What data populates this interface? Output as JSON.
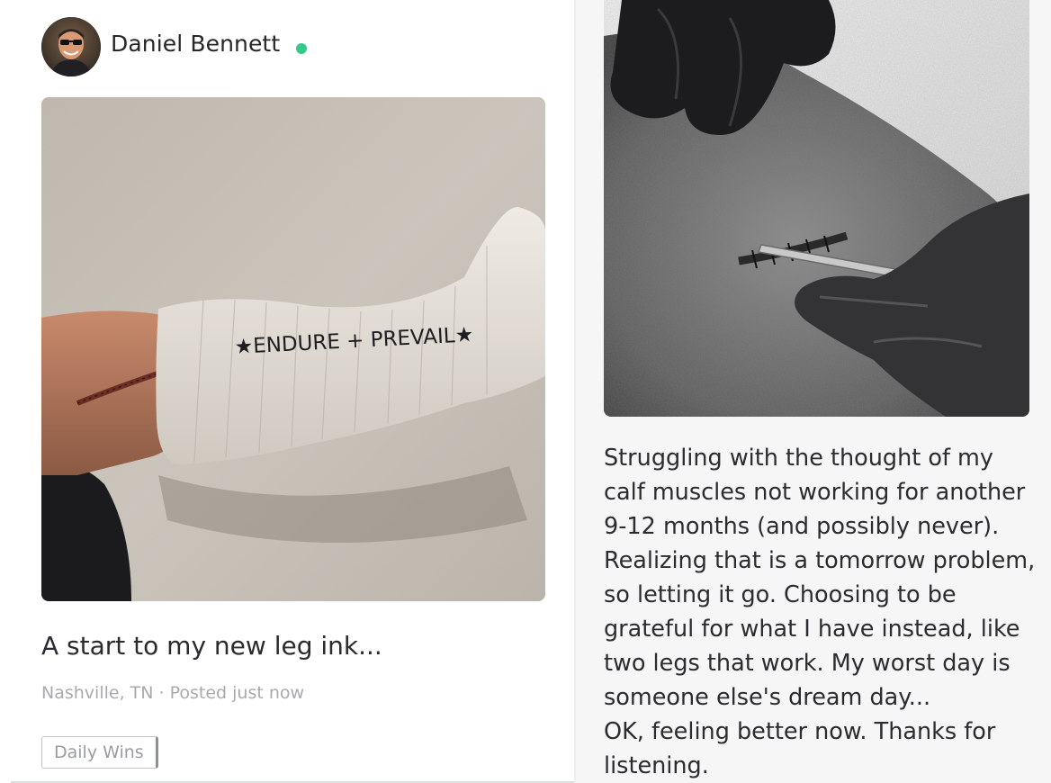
{
  "left_post": {
    "user": {
      "name": "Daniel Bennett",
      "online": true,
      "status_color": "#35c98a"
    },
    "image": {
      "cast_writing": "★ENDURE + PREVAIL★"
    },
    "caption": "A start to my new leg ink...",
    "meta": "Nashville, TN · Posted just now",
    "tag": "Daily Wins"
  },
  "right_post": {
    "text_lines": [
      "Struggling with the thought of my",
      "calf muscles not working for another",
      "9-12 months (and possibly never).",
      "Realizing that is a tomorrow problem,",
      "so letting it go. Choosing to be",
      "grateful for what I have instead, like",
      "two legs that work. My worst day is",
      "someone else's dream day...",
      "OK, feeling better now. Thanks for",
      "listening."
    ]
  },
  "icons": [
    "avatar",
    "online-status-dot"
  ]
}
